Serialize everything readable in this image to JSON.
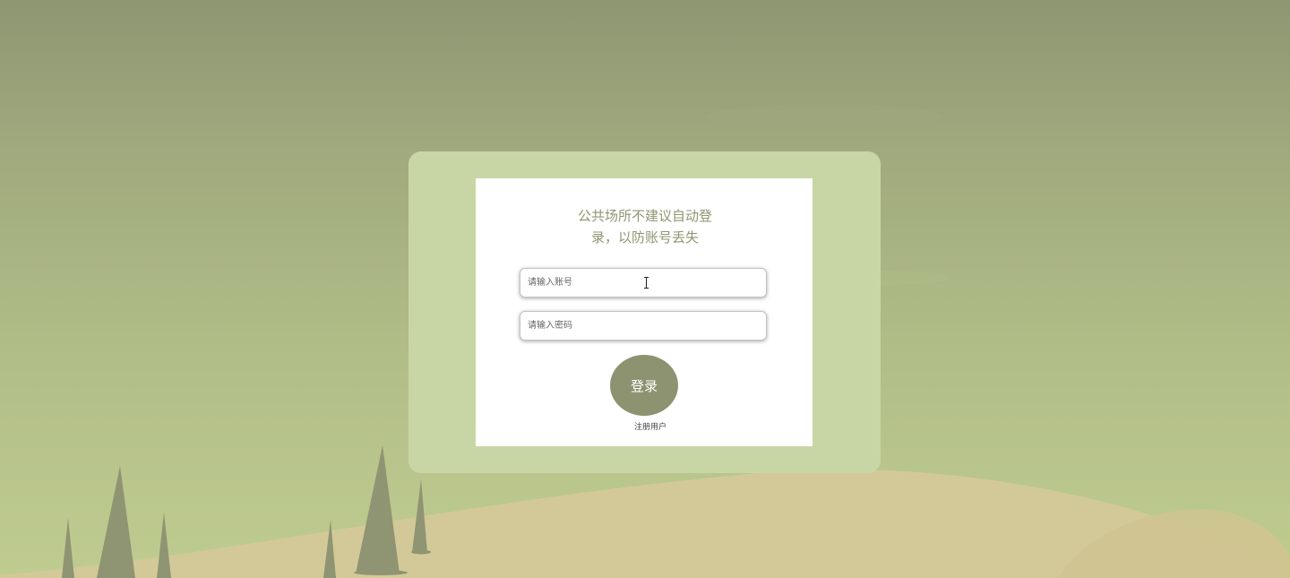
{
  "login": {
    "notice": "公共场所不建议自动登录，以防账号丢失",
    "account_placeholder": "请输入账号",
    "password_placeholder": "请输入密码",
    "login_button": "登录",
    "register_link": "注册用户"
  },
  "colors": {
    "background": "#9fa97d",
    "card": "#c8d6a5",
    "panel": "#ffffff",
    "accent": "#8d9370",
    "notice_text": "#8d9670",
    "hill": "#d3c998",
    "tree": "#8f9472"
  },
  "icons": {
    "text_cursor": "text-cursor-icon"
  }
}
